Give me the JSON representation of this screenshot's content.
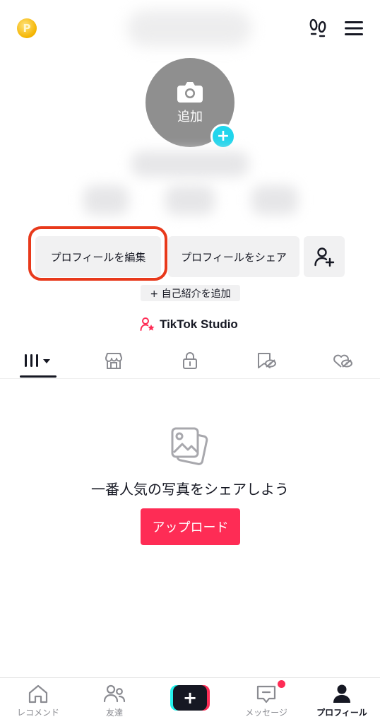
{
  "header": {
    "coin_symbol": "P"
  },
  "avatar": {
    "label": "追加",
    "plus": "+"
  },
  "actions": {
    "edit_profile": "プロフィールを編集",
    "share_profile": "プロフィールをシェア"
  },
  "bio": {
    "add_label": "+ 自己紹介を追加"
  },
  "studio": {
    "label": "TikTok Studio"
  },
  "tabs": [
    {
      "icon": "grid-icon",
      "active": true
    },
    {
      "icon": "shop-icon"
    },
    {
      "icon": "lock-icon"
    },
    {
      "icon": "saved-hidden-icon"
    },
    {
      "icon": "liked-hidden-icon"
    }
  ],
  "empty_state": {
    "message": "一番人気の写真をシェアしよう",
    "upload_label": "アップロード"
  },
  "nav": {
    "home": "レコメンド",
    "friends": "友達",
    "create": "+",
    "inbox": "メッセージ",
    "profile": "プロフィール"
  },
  "colors": {
    "accent": "#fe2c55",
    "cyan": "#20d5ec",
    "highlight": "#e8391b"
  }
}
